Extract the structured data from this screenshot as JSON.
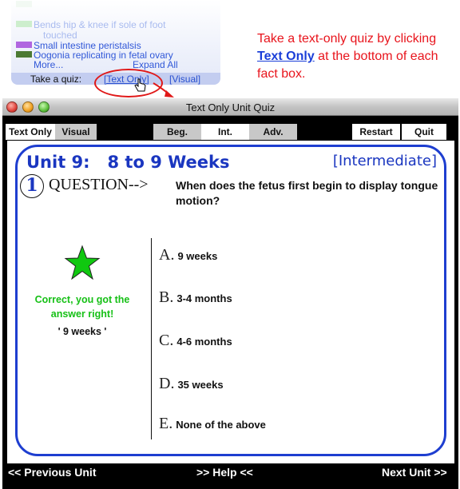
{
  "factbox": {
    "items": [
      {
        "label": "Bends hip & knee if sole of foot",
        "swatch": "#cdeecd",
        "faded": true
      },
      {
        "label": "touched",
        "swatch": "",
        "faded": true
      },
      {
        "label": "Small intestine peristalsis",
        "swatch": "#b066e0",
        "faded": false
      },
      {
        "label": "Oogonia replicating in fetal ovary",
        "swatch": "#4c7a34",
        "faded": false
      }
    ],
    "more_label": "More...",
    "expand_all_label": "Expand All",
    "take_quiz_label": "Take a quiz:",
    "text_only_link": "[Text Only]",
    "visual_link": "[Visual]"
  },
  "callout": {
    "line_before": "Take a text-only quiz by clicking ",
    "highlight": "Text Only",
    "line_after": " at the bottom of each fact box."
  },
  "window": {
    "title": "Text Only Unit Quiz",
    "traffic_lights": {
      "close": "#e0443c",
      "minimize": "#f0a020",
      "zoom": "#5cc03c"
    }
  },
  "toolbar": {
    "text_only": "Text Only",
    "visual": "Visual",
    "beg": "Beg.",
    "int": "Int.",
    "adv": "Adv.",
    "restart": "Restart",
    "quit": "Quit"
  },
  "quiz": {
    "unit_title": "Unit 9:   8 to 9 Weeks",
    "level": "[Intermediate]",
    "question_number": "1",
    "question_label": "QUESTION-->",
    "question_text": "When does the fetus first begin to display tongue motion?",
    "feedback": {
      "status_icon": "star-icon",
      "message": "Correct, you got the answer right!",
      "answer": "' 9 weeks '",
      "color": "#16c016"
    },
    "options": [
      {
        "letter": "A.",
        "text": "9 weeks"
      },
      {
        "letter": "B.",
        "text": "3-4 months"
      },
      {
        "letter": "C.",
        "text": "4-6 months"
      },
      {
        "letter": "D.",
        "text": "35 weeks"
      },
      {
        "letter": "E.",
        "text": "None of the above"
      }
    ]
  },
  "footer": {
    "previous": "<< Previous Unit",
    "help": ">> Help <<",
    "next": "Next Unit >>"
  },
  "colors": {
    "accent_blue": "#1e3ed0",
    "callout_red": "#e8141c"
  }
}
